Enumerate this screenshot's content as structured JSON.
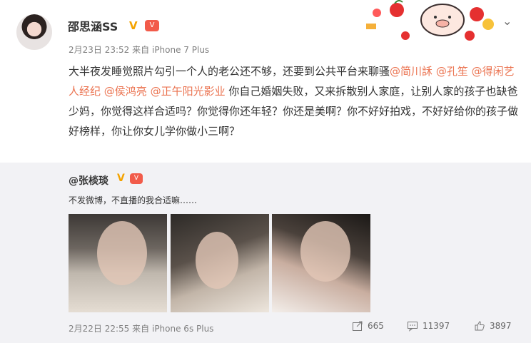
{
  "post": {
    "author": "邵思涵SS",
    "verified_mark": "V",
    "vip_mark": "ᵥ",
    "time": "2月23日 23:52",
    "source_prefix": "来自",
    "source": "iPhone 7 Plus",
    "text_parts": [
      {
        "t": "大半夜发睡觉照片勾引一个人的老公还不够，还要到公共平台来聊骚",
        "mention": false
      },
      {
        "t": "@简川訸",
        "mention": true
      },
      {
        "t": " ",
        "mention": false
      },
      {
        "t": "@孔笙",
        "mention": true
      },
      {
        "t": " ",
        "mention": false
      },
      {
        "t": "@得闲艺人经纪",
        "mention": true
      },
      {
        "t": " ",
        "mention": false
      },
      {
        "t": "@侯鸿亮",
        "mention": true
      },
      {
        "t": " ",
        "mention": false
      },
      {
        "t": "@正午阳光影业",
        "mention": true
      },
      {
        "t": " 你自己婚姻失败，又来拆散别人家庭，让别人家的孩子也缺爸少妈，你觉得这样合适吗？你觉得你还年轻？你还是美啊？你不好好拍戏，不好好给你的孩子做好榜样，你让你女儿学你做小三啊？",
        "mention": false
      }
    ]
  },
  "repost": {
    "author": "@张棪琰",
    "verified_mark": "V",
    "vip_mark": "ᵥ",
    "text": "不发微博，不直播的我合适嘛……",
    "time": "2月22日 22:55",
    "source_prefix": "来自",
    "source": "iPhone 6s Plus",
    "stats": {
      "reposts": "665",
      "comments": "11397",
      "likes": "3897"
    }
  },
  "icons": {
    "menu": "chevron-down-icon",
    "repost": "repost-icon",
    "comment": "comment-icon",
    "like": "thumbs-up-icon"
  },
  "colors": {
    "mention": "#eb7350",
    "verified": "#f4a300",
    "repost_bg": "#f2f2f5"
  }
}
